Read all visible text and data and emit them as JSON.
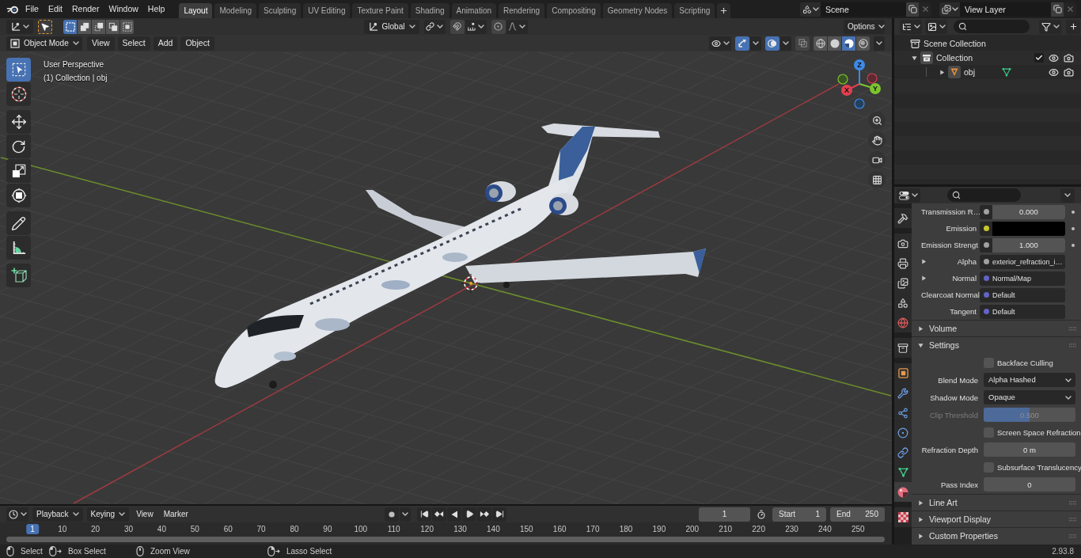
{
  "topbar": {
    "menus": [
      "File",
      "Edit",
      "Render",
      "Window",
      "Help"
    ],
    "workspaces": [
      {
        "label": "Layout",
        "selected": true
      },
      {
        "label": "Modeling",
        "selected": false
      },
      {
        "label": "Sculpting",
        "selected": false
      },
      {
        "label": "UV Editing",
        "selected": false
      },
      {
        "label": "Texture Paint",
        "selected": false
      },
      {
        "label": "Shading",
        "selected": false
      },
      {
        "label": "Animation",
        "selected": false
      },
      {
        "label": "Rendering",
        "selected": false
      },
      {
        "label": "Compositing",
        "selected": false
      },
      {
        "label": "Geometry Nodes",
        "selected": false
      },
      {
        "label": "Scripting",
        "selected": false
      }
    ],
    "scene": "Scene",
    "view_layer": "View Layer"
  },
  "tool_header": {
    "select_modes": [
      {
        "kind": "set",
        "selected": true
      },
      {
        "kind": "extend",
        "selected": false
      },
      {
        "kind": "subtract",
        "selected": false
      },
      {
        "kind": "invert",
        "selected": false
      },
      {
        "kind": "intersect",
        "selected": false
      }
    ],
    "orientation": "Global",
    "snap_on": false,
    "proportional_on": false,
    "options": "Options"
  },
  "viewport_header": {
    "mode": "Object Mode",
    "menus": [
      "View",
      "Select",
      "Add",
      "Object"
    ],
    "gizmos_on": true,
    "overlays_on": true,
    "xray_on": false,
    "shading": [
      {
        "kind": "wireframe",
        "selected": false
      },
      {
        "kind": "solid",
        "selected": false
      },
      {
        "kind": "material",
        "selected": true
      },
      {
        "kind": "rendered",
        "selected": false
      }
    ]
  },
  "toolbar": [
    {
      "tools": [
        {
          "kind": "select_box",
          "selected": true
        },
        {
          "kind": "cursor",
          "selected": false
        }
      ]
    },
    {
      "tools": [
        {
          "kind": "move",
          "selected": false
        },
        {
          "kind": "rotate",
          "selected": false
        },
        {
          "kind": "scale",
          "selected": false
        },
        {
          "kind": "transform",
          "selected": false
        }
      ]
    },
    {
      "tools": [
        {
          "kind": "annotate",
          "selected": false
        },
        {
          "kind": "measure",
          "selected": false
        }
      ]
    },
    {
      "tools": [
        {
          "kind": "add_cube",
          "selected": false
        }
      ]
    }
  ],
  "viewport": {
    "view_name": "User Perspective",
    "context": "(1) Collection | obj",
    "gizmo_axes": [
      "X",
      "Y",
      "Z"
    ]
  },
  "outliner": {
    "root": "Scene Collection",
    "items": [
      {
        "label": "Collection",
        "kind": "collection",
        "expanded": true,
        "checked": true,
        "children": [
          {
            "label": "obj",
            "kind": "mesh_object",
            "expanded": false
          }
        ]
      }
    ]
  },
  "properties": {
    "tab_groups": [
      {
        "tabs": [
          {
            "kind": "tool",
            "selected": false
          }
        ]
      },
      {
        "tabs": [
          {
            "kind": "render",
            "selected": false
          },
          {
            "kind": "output",
            "selected": false
          },
          {
            "kind": "view_layer",
            "selected": false
          },
          {
            "kind": "scene",
            "selected": false
          },
          {
            "kind": "world",
            "selected": false
          }
        ]
      },
      {
        "tabs": [
          {
            "kind": "collection",
            "selected": false
          }
        ]
      },
      {
        "tabs": [
          {
            "kind": "object",
            "selected": false
          },
          {
            "kind": "modifiers",
            "selected": false
          },
          {
            "kind": "particles",
            "selected": false
          },
          {
            "kind": "physics",
            "selected": false
          },
          {
            "kind": "constraints",
            "selected": false
          },
          {
            "kind": "data",
            "selected": false
          },
          {
            "kind": "material",
            "selected": true
          }
        ]
      },
      {
        "tabs": [
          {
            "kind": "texture",
            "selected": false
          }
        ]
      }
    ],
    "inputs": [
      {
        "label": "Transmission R…",
        "kind": "number",
        "color": "#a1a1a1",
        "value": "0.000"
      },
      {
        "label": "Emission",
        "kind": "color",
        "color": "#c7c729"
      },
      {
        "label": "Emission Strengt",
        "kind": "number",
        "color": "#a1a1a1",
        "value": "1.000"
      },
      {
        "label": "Alpha",
        "kind": "node",
        "color": "#a1a1a1",
        "value": "exterior_refraction_i…",
        "expanded": false
      },
      {
        "label": "Normal",
        "kind": "node",
        "color": "#6363c7",
        "value": "Normal/Map",
        "expanded": false
      },
      {
        "label": "Clearcoat Normal",
        "kind": "vector",
        "color": "#6363c7",
        "value": "Default"
      },
      {
        "label": "Tangent",
        "kind": "vector",
        "color": "#6363c7",
        "value": "Default"
      }
    ],
    "panels": [
      {
        "title": "Volume",
        "expanded": false
      },
      {
        "title": "Settings",
        "expanded": true,
        "rows": [
          {
            "kind": "checkbox",
            "label": "Backface Culling",
            "checked": false,
            "disabled": false
          },
          {
            "kind": "dropdown",
            "label": "Blend Mode",
            "value": "Alpha Hashed",
            "disabled": false
          },
          {
            "kind": "dropdown",
            "label": "Shadow Mode",
            "value": "Opaque",
            "disabled": false
          },
          {
            "kind": "slider",
            "label": "Clip Threshold",
            "value": "0.500",
            "level": 0.5,
            "disabled": true
          },
          {
            "kind": "checkbox",
            "label": "Screen Space Refraction",
            "checked": false,
            "disabled": false
          },
          {
            "kind": "number",
            "label": "Refraction Depth",
            "value": "0 m",
            "disabled": false
          },
          {
            "kind": "checkbox",
            "label": "Subsurface Translucency",
            "checked": false,
            "disabled": false
          },
          {
            "kind": "number",
            "label": "Pass Index",
            "value": "0",
            "disabled": false
          }
        ]
      },
      {
        "title": "Line Art",
        "expanded": false
      },
      {
        "title": "Viewport Display",
        "expanded": false
      },
      {
        "title": "Custom Properties",
        "expanded": false
      }
    ]
  },
  "timeline": {
    "menus": [
      {
        "label": "Playback",
        "kind": "dropdown"
      },
      {
        "label": "Keying",
        "kind": "dropdown"
      },
      {
        "label": "View",
        "kind": "menu"
      },
      {
        "label": "Marker",
        "kind": "menu"
      }
    ],
    "auto_keying": false,
    "current_frame": "1",
    "start_label": "Start",
    "start": "1",
    "end_label": "End",
    "end": "250",
    "ruler": [
      {
        "label": "1",
        "selected": true
      },
      {
        "label": "10",
        "selected": false
      },
      {
        "label": "20",
        "selected": false
      },
      {
        "label": "30",
        "selected": false
      },
      {
        "label": "40",
        "selected": false
      },
      {
        "label": "50",
        "selected": false
      },
      {
        "label": "60",
        "selected": false
      },
      {
        "label": "70",
        "selected": false
      },
      {
        "label": "80",
        "selected": false
      },
      {
        "label": "90",
        "selected": false
      },
      {
        "label": "100",
        "selected": false
      },
      {
        "label": "110",
        "selected": false
      },
      {
        "label": "120",
        "selected": false
      },
      {
        "label": "130",
        "selected": false
      },
      {
        "label": "140",
        "selected": false
      },
      {
        "label": "150",
        "selected": false
      },
      {
        "label": "160",
        "selected": false
      },
      {
        "label": "170",
        "selected": false
      },
      {
        "label": "180",
        "selected": false
      },
      {
        "label": "190",
        "selected": false
      },
      {
        "label": "200",
        "selected": false
      },
      {
        "label": "210",
        "selected": false
      },
      {
        "label": "220",
        "selected": false
      },
      {
        "label": "230",
        "selected": false
      },
      {
        "label": "240",
        "selected": false
      },
      {
        "label": "250",
        "selected": false
      }
    ]
  },
  "status_bar": {
    "hints": [
      {
        "kind": "click",
        "label": "Select"
      },
      {
        "kind": "drag",
        "label": "Box Select"
      },
      {
        "kind": "middle",
        "label": "Zoom View"
      },
      {
        "kind": "right_drag",
        "label": "Lasso Select"
      }
    ],
    "version": "2.93.8"
  }
}
